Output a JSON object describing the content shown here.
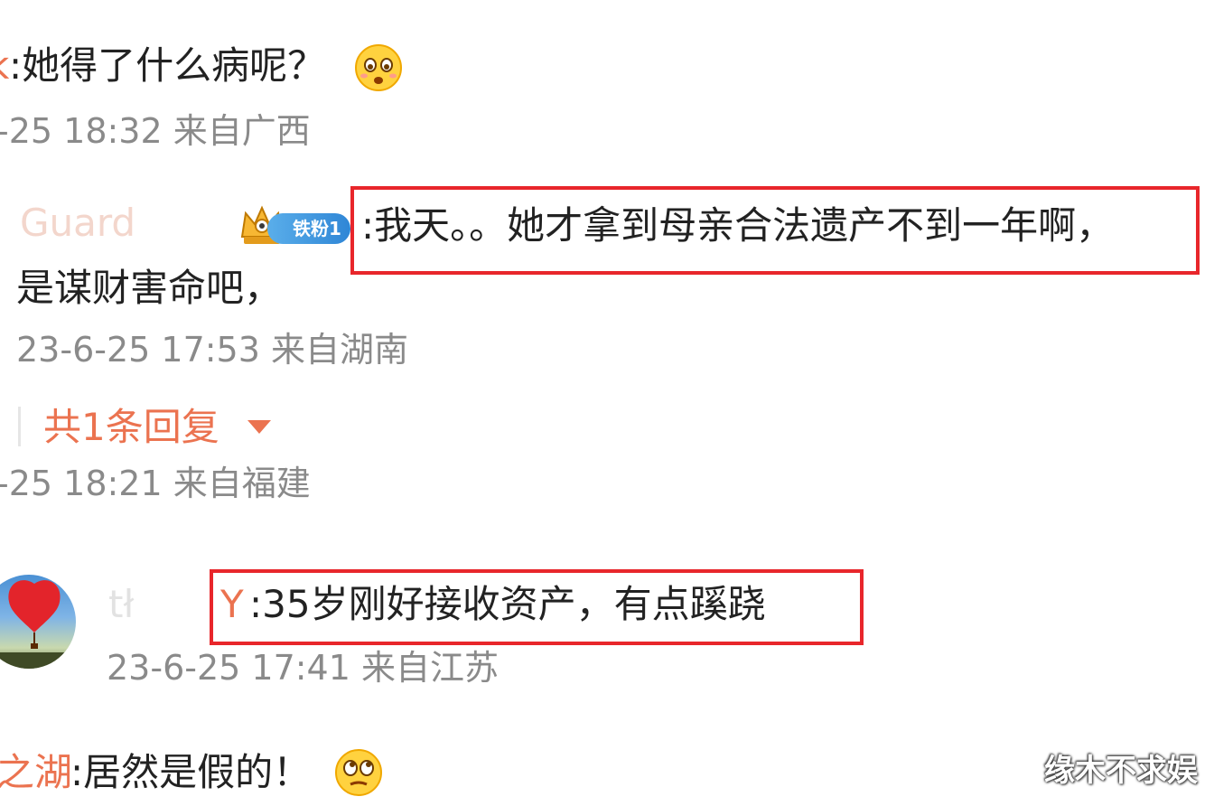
{
  "comments": [
    {
      "name_tail": "k",
      "text": ":她得了什么病呢？",
      "emoji": "crying-face-emoji",
      "meta": "-25 18:32 来自广西"
    },
    {
      "name": "Guard",
      "badge": "铁粉1",
      "text": ":我天。。她才拿到母亲合法遗产不到一年啊，",
      "text_cont": "是谋财害命吧，",
      "meta": "23-6-25 17:53 来自湖南"
    },
    {
      "reply_count": "共1条回复",
      "meta": "-25 18:21 来自福建"
    },
    {
      "name_tail": "Y",
      "text": ":35岁刚好接收资产，有点蹊跷",
      "meta": "23-6-25 17:41 来自江苏"
    },
    {
      "name_tail": "之湖",
      "text": ":居然是假的！",
      "emoji": "rolling-eyes-emoji"
    }
  ],
  "watermark": "缘木不求娱",
  "colors": {
    "highlight_box": "#e8262b",
    "username": "#eb7350",
    "meta": "#8a8a8a"
  }
}
